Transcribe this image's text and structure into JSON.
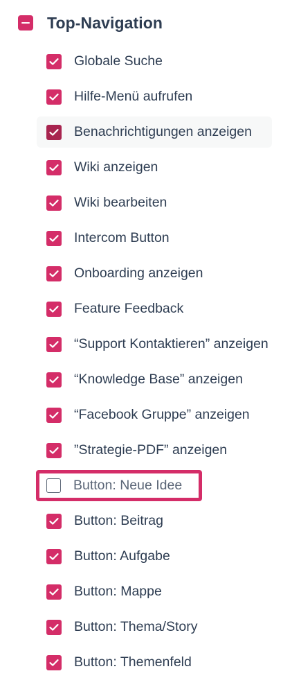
{
  "group": {
    "title": "Top-Navigation",
    "toggle_icon": "minus-square-icon",
    "accent_color": "#d42d68"
  },
  "items": [
    {
      "label": "Globale Suche",
      "checked": true
    },
    {
      "label": "Hilfe-Menü aufrufen",
      "checked": true
    },
    {
      "label": "Benachrichtigungen anzeigen",
      "checked": true,
      "hovered": true
    },
    {
      "label": "Wiki anzeigen",
      "checked": true
    },
    {
      "label": "Wiki bearbeiten",
      "checked": true
    },
    {
      "label": "Intercom Button",
      "checked": true
    },
    {
      "label": "Onboarding anzeigen",
      "checked": true
    },
    {
      "label": "Feature Feedback",
      "checked": true
    },
    {
      "label": "“Support Kontaktieren” anzeigen",
      "checked": true
    },
    {
      "label": "“Knowledge Base” anzeigen",
      "checked": true
    },
    {
      "label": "“Facebook Gruppe” anzeigen",
      "checked": true
    },
    {
      "label": "”Strategie-PDF” anzeigen",
      "checked": true
    },
    {
      "label": "Button: Neue Idee",
      "checked": false,
      "highlighted": true
    },
    {
      "label": "Button: Beitrag",
      "checked": true
    },
    {
      "label": "Button: Aufgabe",
      "checked": true
    },
    {
      "label": "Button: Mappe",
      "checked": true
    },
    {
      "label": "Button: Thema/Story",
      "checked": true
    },
    {
      "label": "Button: Themenfeld",
      "checked": true
    }
  ]
}
